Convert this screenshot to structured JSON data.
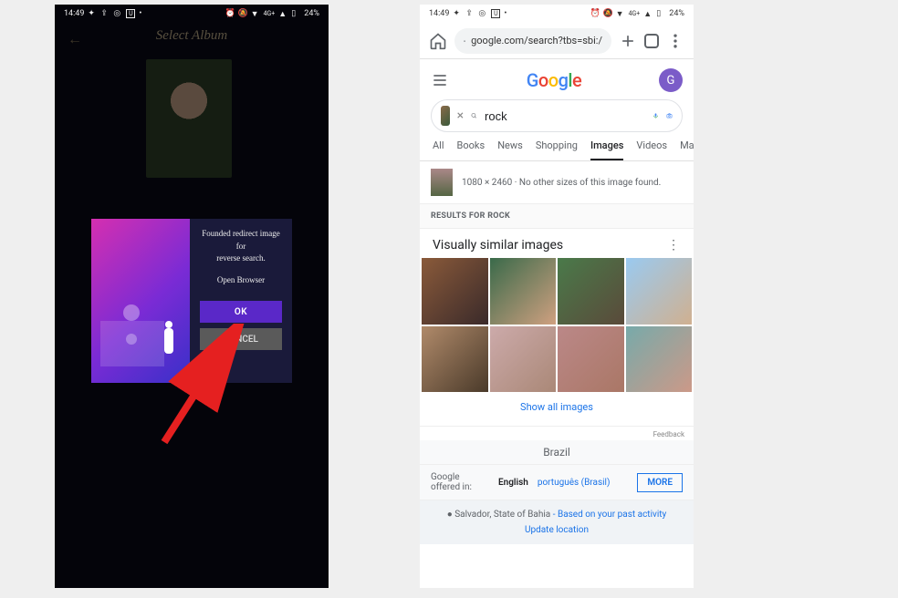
{
  "status": {
    "time": "14:49",
    "battery": "24%",
    "signal": "4G+"
  },
  "left": {
    "title": "Select Album",
    "modal": {
      "line1": "Founded redirect image",
      "line2": "for",
      "line3": "reverse search.",
      "line4": "Open Browser",
      "ok": "OK",
      "cancel": "CANCEL"
    }
  },
  "right": {
    "url": "google.com/search?tbs=sbi:/",
    "avatar_letter": "G",
    "logo": [
      "G",
      "o",
      "o",
      "g",
      "l",
      "e"
    ],
    "query": "rock",
    "tabs": [
      "All",
      "Books",
      "News",
      "Shopping",
      "Images",
      "Videos",
      "Maps"
    ],
    "active_tab": 4,
    "size_line": "1080 × 2460 · No other sizes of this image found.",
    "results_for": "RESULTS FOR ROCK",
    "similar_heading": "Visually similar images",
    "show_all": "Show all images",
    "feedback": "Feedback",
    "country": "Brazil",
    "lang_label": "Google offered in:",
    "lang_en": "English",
    "lang_pt": "português (Brasil)",
    "more": "MORE",
    "location_prefix": "● Salvador, State of Bahia",
    "location_suffix": " - Based on your past activity",
    "update_location": "Update location"
  }
}
